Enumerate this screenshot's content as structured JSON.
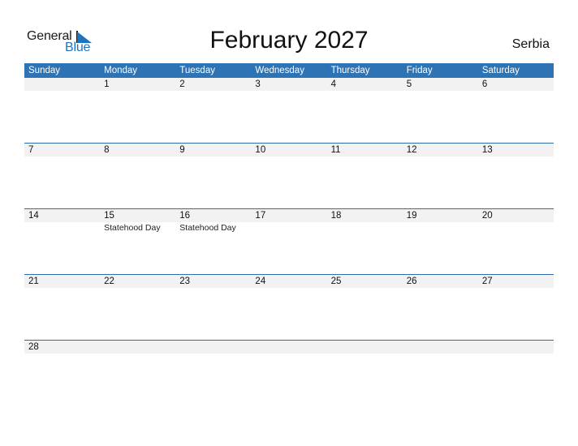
{
  "logo": {
    "word1": "General",
    "word2": "Blue"
  },
  "title": "February 2027",
  "country": "Serbia",
  "colors": {
    "header": "#2e74b5",
    "date_strip": "#f2f2f2",
    "logo_blue": "#1f74c0"
  },
  "weekdays": [
    "Sunday",
    "Monday",
    "Tuesday",
    "Wednesday",
    "Thursday",
    "Friday",
    "Saturday"
  ],
  "weeks": [
    [
      {
        "d": ""
      },
      {
        "d": "1"
      },
      {
        "d": "2"
      },
      {
        "d": "3"
      },
      {
        "d": "4"
      },
      {
        "d": "5"
      },
      {
        "d": "6"
      }
    ],
    [
      {
        "d": "7"
      },
      {
        "d": "8"
      },
      {
        "d": "9"
      },
      {
        "d": "10"
      },
      {
        "d": "11"
      },
      {
        "d": "12"
      },
      {
        "d": "13"
      }
    ],
    [
      {
        "d": "14"
      },
      {
        "d": "15",
        "h": "Statehood Day"
      },
      {
        "d": "16",
        "h": "Statehood Day"
      },
      {
        "d": "17"
      },
      {
        "d": "18"
      },
      {
        "d": "19"
      },
      {
        "d": "20"
      }
    ],
    [
      {
        "d": "21"
      },
      {
        "d": "22"
      },
      {
        "d": "23"
      },
      {
        "d": "24"
      },
      {
        "d": "25"
      },
      {
        "d": "26"
      },
      {
        "d": "27"
      }
    ],
    [
      {
        "d": "28"
      },
      {
        "d": ""
      },
      {
        "d": ""
      },
      {
        "d": ""
      },
      {
        "d": ""
      },
      {
        "d": ""
      },
      {
        "d": ""
      }
    ]
  ]
}
